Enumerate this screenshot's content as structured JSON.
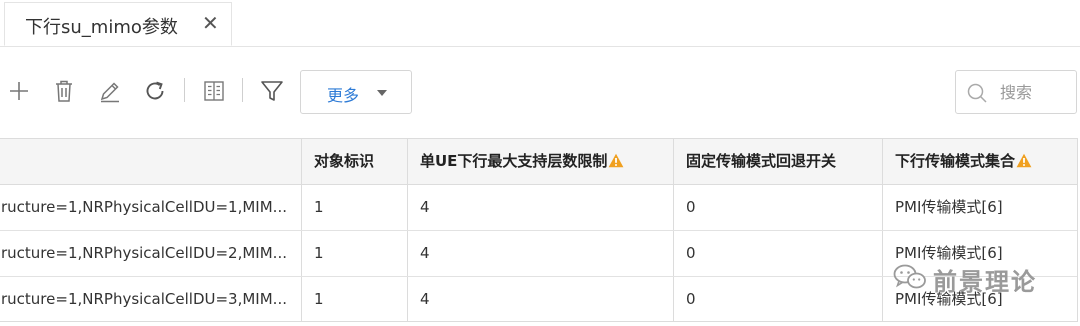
{
  "tab": {
    "label": "下行su_mimo参数",
    "close_glyph": "✕"
  },
  "toolbar": {
    "icons": [
      "plus-icon",
      "trash-icon",
      "edit-pencil-icon",
      "refresh-icon",
      "columns-icon",
      "filter-icon"
    ],
    "more_label": "更多",
    "search_placeholder": "搜索"
  },
  "table": {
    "headers": [
      "",
      "对象标识",
      "单UE下行最大支持层数限制",
      "固定传输模式回退开关",
      "下行传输模式集合"
    ],
    "header_warnings": [
      false,
      false,
      true,
      false,
      true
    ],
    "rows": [
      [
        "ructure=1,NRPhysicalCellDU=1,MIM...",
        "1",
        "4",
        "0",
        "PMI传输模式[6]"
      ],
      [
        "ructure=1,NRPhysicalCellDU=2,MIM...",
        "1",
        "4",
        "0",
        "PMI传输模式[6]"
      ],
      [
        "ructure=1,NRPhysicalCellDU=3,MIM...",
        "1",
        "4",
        "0",
        "PMI传输模式[6]"
      ]
    ]
  },
  "watermark": {
    "text": "前景理论",
    "icon": "wechat-logo-icon"
  },
  "colors": {
    "accent": "#2e7bd6",
    "warning": "#f0a020",
    "header_bg": "#f5f5f5",
    "border": "#dcdcdc"
  }
}
